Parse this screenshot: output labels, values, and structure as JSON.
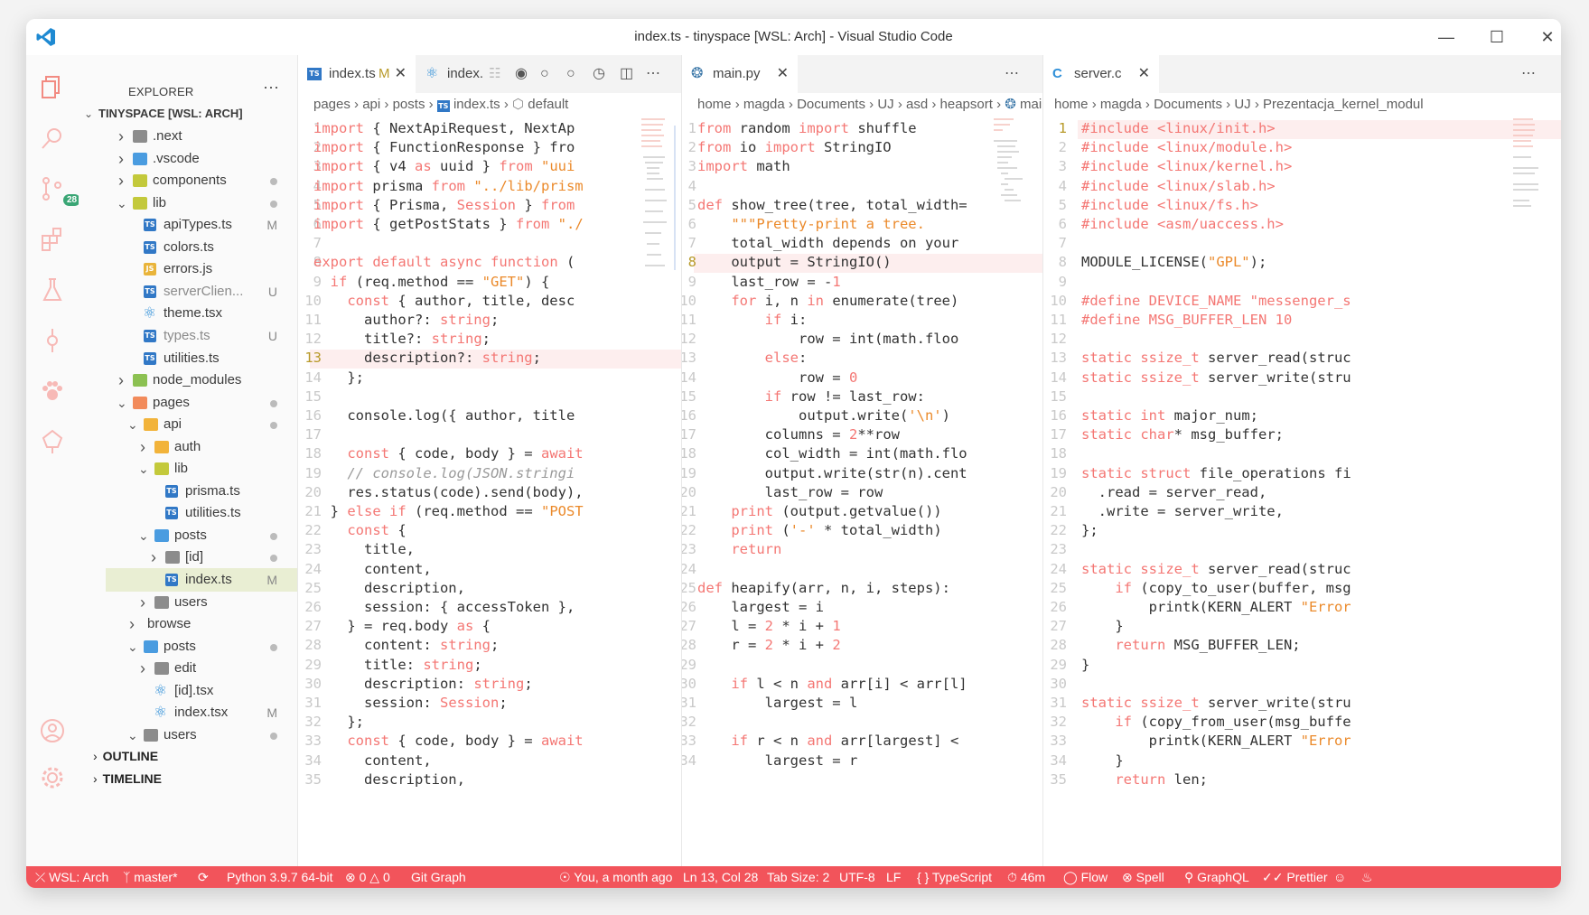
{
  "window": {
    "title": "index.ts - tinyspace [WSL: Arch] - Visual Studio Code"
  },
  "activity": {
    "scm_badge": "28"
  },
  "explorer": {
    "title": "EXPLORER",
    "root": "TINYSPACE [WSL: ARCH]",
    "items": [
      {
        "name": ".next",
        "stat": ""
      },
      {
        "name": ".vscode",
        "stat": ""
      },
      {
        "name": "components",
        "stat": ""
      },
      {
        "name": "lib",
        "stat": ""
      },
      {
        "name": "apiTypes.ts",
        "stat": "M"
      },
      {
        "name": "colors.ts",
        "stat": ""
      },
      {
        "name": "errors.js",
        "stat": ""
      },
      {
        "name": "serverClien...",
        "stat": "U"
      },
      {
        "name": "theme.tsx",
        "stat": ""
      },
      {
        "name": "types.ts",
        "stat": "U"
      },
      {
        "name": "utilities.ts",
        "stat": ""
      },
      {
        "name": "node_modules",
        "stat": ""
      },
      {
        "name": "pages",
        "stat": ""
      },
      {
        "name": "api",
        "stat": ""
      },
      {
        "name": "auth",
        "stat": ""
      },
      {
        "name": "lib",
        "stat": ""
      },
      {
        "name": "prisma.ts",
        "stat": ""
      },
      {
        "name": "utilities.ts",
        "stat": ""
      },
      {
        "name": "posts",
        "stat": ""
      },
      {
        "name": "[id]",
        "stat": ""
      },
      {
        "name": "index.ts",
        "stat": "M"
      },
      {
        "name": "users",
        "stat": ""
      },
      {
        "name": "browse",
        "stat": ""
      },
      {
        "name": "posts",
        "stat": ""
      },
      {
        "name": "edit",
        "stat": ""
      },
      {
        "name": "[id].tsx",
        "stat": ""
      },
      {
        "name": "index.tsx",
        "stat": "M"
      },
      {
        "name": "users",
        "stat": ""
      }
    ],
    "outline": "OUTLINE",
    "timeline": "TIMELINE"
  },
  "editor1": {
    "tab1": "index.ts",
    "tab1_mod": "M",
    "tab2": "index.",
    "crumbs": [
      "pages",
      "api",
      "posts",
      "index.ts",
      "default"
    ],
    "lines": [
      "import { NextApiRequest, NextAp",
      "import { FunctionResponse } fro",
      "import { v4 as uuid } from \"uui",
      "import prisma from \"../lib/prism",
      "import { Prisma, Session } from",
      "import { getPostStats } from \"./",
      "",
      "export default async function (",
      "  if (req.method == \"GET\") {",
      "    const { author, title, desc",
      "      author?: string;",
      "      title?: string;",
      "      description?: string;",
      "    };",
      "",
      "    console.log({ author, title",
      "",
      "    const { code, body } = await",
      "    // console.log(JSON.stringi",
      "    res.status(code).send(body),",
      "  } else if (req.method == \"POST",
      "    const {",
      "      title,",
      "      content,",
      "      description,",
      "      session: { accessToken },",
      "    } = req.body as {",
      "      content: string;",
      "      title: string;",
      "      description: string;",
      "      session: Session;",
      "    };",
      "    const { code, body } = await",
      "      content,",
      "      description,"
    ],
    "current": "13"
  },
  "editor2": {
    "tab": "main.py",
    "crumbs": [
      "home",
      "magda",
      "Documents",
      "UJ",
      "asd",
      "heapsort",
      "main"
    ],
    "lines": [
      "from random import shuffle",
      "from io import StringIO",
      "import math",
      "",
      "def show_tree(tree, total_width=",
      "    \"\"\"Pretty-print a tree.",
      "    total_width depends on your",
      "    output = StringIO()",
      "    last_row = -1",
      "    for i, n in enumerate(tree)",
      "        if i:",
      "            row = int(math.floo",
      "        else:",
      "            row = 0",
      "        if row != last_row:",
      "            output.write('\\n')",
      "        columns = 2**row",
      "        col_width = int(math.flo",
      "        output.write(str(n).cent",
      "        last_row = row",
      "    print (output.getvalue())",
      "    print ('-' * total_width)",
      "    return",
      "",
      "def heapify(arr, n, i, steps):",
      "    largest = i",
      "    l = 2 * i + 1",
      "    r = 2 * i + 2",
      "",
      "    if l < n and arr[i] < arr[l]",
      "        largest = l",
      "",
      "    if r < n and arr[largest] <",
      "        largest = r"
    ],
    "current": "8"
  },
  "editor3": {
    "tab": "server.c",
    "crumbs": [
      "home",
      "magda",
      "Documents",
      "UJ",
      "Prezentacja_kernel_modul"
    ],
    "lines": [
      "#include <linux/init.h>",
      "#include <linux/module.h>",
      "#include <linux/kernel.h>",
      "#include <linux/slab.h>",
      "#include <linux/fs.h>",
      "#include <asm/uaccess.h>",
      "",
      "MODULE_LICENSE(\"GPL\");",
      "",
      "#define DEVICE_NAME \"messenger_s",
      "#define MSG_BUFFER_LEN 10",
      "",
      "static ssize_t server_read(struc",
      "static ssize_t server_write(stru",
      "",
      "static int major_num;",
      "static char* msg_buffer;",
      "",
      "static struct file_operations fi",
      "  .read = server_read,",
      "  .write = server_write,",
      "};",
      "",
      "static ssize_t server_read(struc",
      "    if (copy_to_user(buffer, msg",
      "        printk(KERN_ALERT \"Error",
      "    }",
      "    return MSG_BUFFER_LEN;",
      "}",
      "",
      "static ssize_t server_write(stru",
      "    if (copy_from_user(msg_buffe",
      "        printk(KERN_ALERT \"Error",
      "    }",
      "    return len;"
    ],
    "current": "1"
  },
  "status": {
    "remote": "WSL: Arch",
    "branch": "master*",
    "python": "Python 3.9.7 64-bit",
    "problems": "0",
    "warnings": "0",
    "gitgraph": "Git Graph",
    "blame": "You, a month ago",
    "position": "Ln 13, Col 28",
    "tabsize": "Tab Size: 2",
    "encoding": "UTF-8",
    "eol": "LF",
    "language": "TypeScript",
    "time": "46m",
    "flow": "Flow",
    "spell": "Spell",
    "graphql": "GraphQL",
    "prettier": "Prettier"
  }
}
